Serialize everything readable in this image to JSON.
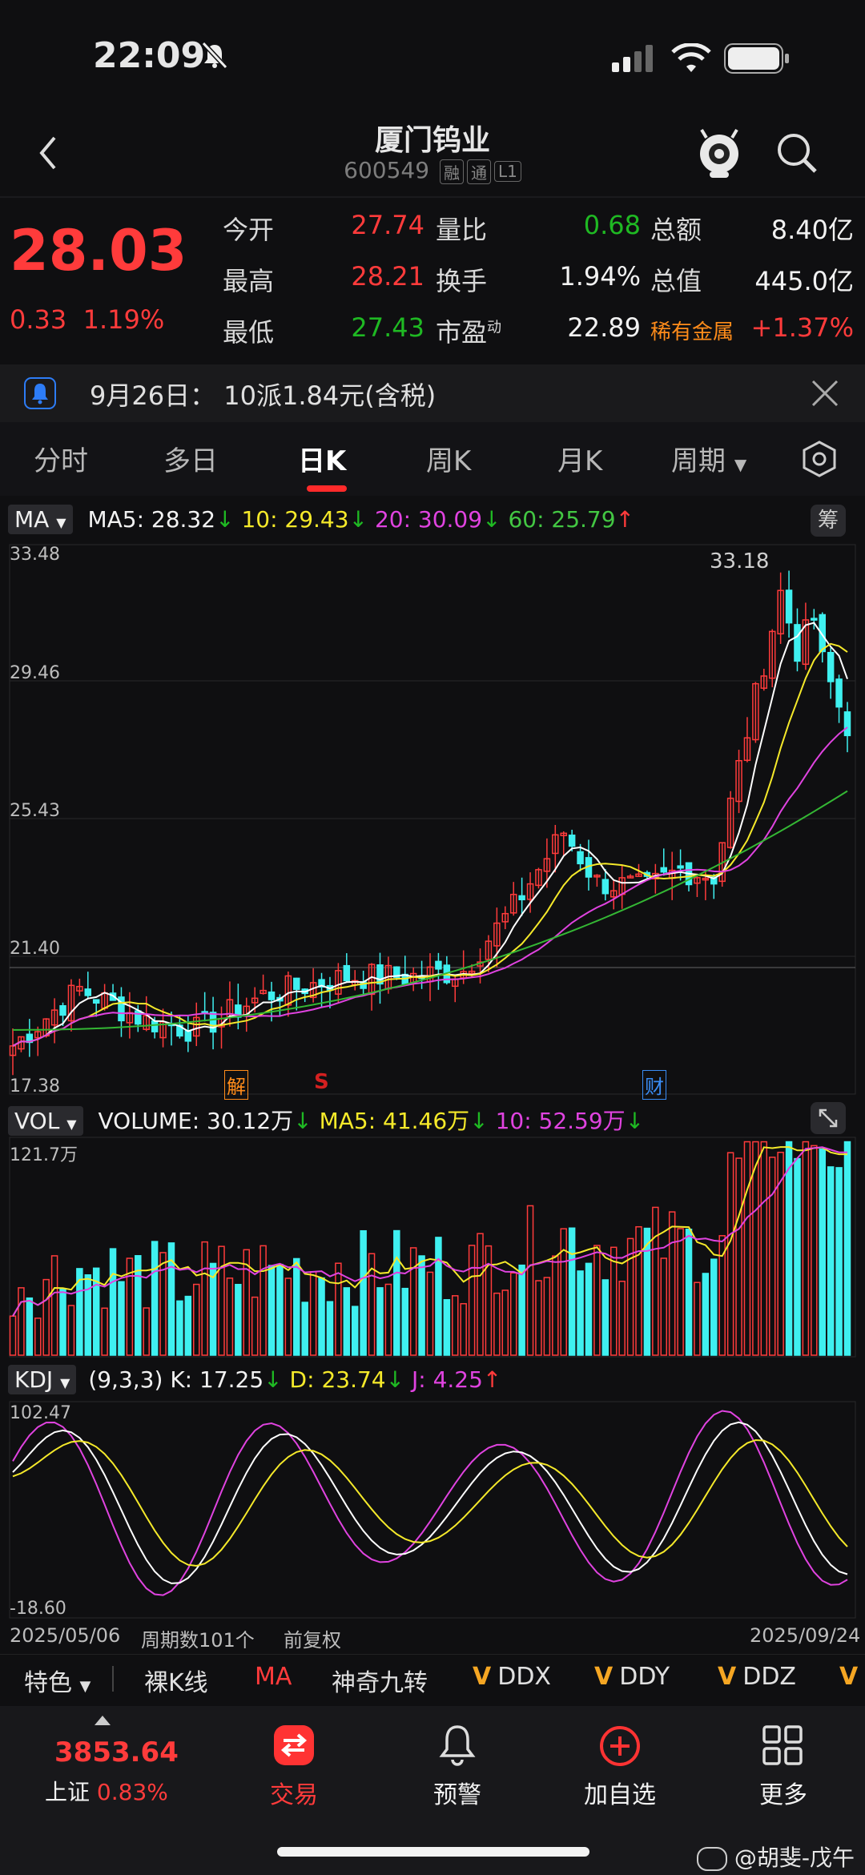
{
  "status": {
    "time": "22:09"
  },
  "nav": {
    "title": "厦门钨业",
    "code": "600549",
    "tags": [
      "融",
      "通",
      "L1"
    ]
  },
  "quote": {
    "price": "28.03",
    "change": "0.33",
    "change_pct": "1.19%",
    "rows": [
      [
        {
          "label": "今开",
          "value": "27.74",
          "color": "red"
        },
        {
          "label": "量比",
          "value": "0.68",
          "color": "green"
        },
        {
          "label": "总额",
          "value": "8.40亿",
          "color": "white"
        }
      ],
      [
        {
          "label": "最高",
          "value": "28.21",
          "color": "red"
        },
        {
          "label": "换手",
          "value": "1.94%",
          "color": "white"
        },
        {
          "label": "总值",
          "value": "445.0亿",
          "color": "white"
        }
      ],
      [
        {
          "label": "最低",
          "value": "27.43",
          "color": "green"
        },
        {
          "label": "市盈",
          "sup": "动",
          "value": "22.89",
          "color": "white"
        },
        {
          "label": "稀有金属",
          "value": "+1.37%",
          "color": "red"
        }
      ]
    ]
  },
  "notice": {
    "text": "9月26日：  10派1.84元(含税)"
  },
  "tabs": [
    "分时",
    "多日",
    "日K",
    "周K",
    "月K",
    "周期"
  ],
  "active_tab": 2,
  "ma_legend": {
    "selector": "MA",
    "ma5": "MA5: 28.32",
    "ma10": "10: 29.43",
    "ma20": "20: 30.09",
    "ma60": "60: 25.79",
    "badge": "筹"
  },
  "price_axis": [
    "33.48",
    "29.46",
    "25.43",
    "21.40",
    "17.38"
  ],
  "peak_label": "33.18",
  "markers": {
    "jie": "解",
    "s": "S",
    "cai": "财"
  },
  "vol_legend": {
    "selector": "VOL",
    "volume": "VOLUME: 30.12万",
    "ma5": "MA5: 41.46万",
    "ma10": "10: 52.59万"
  },
  "vol_axis": [
    "121.7万"
  ],
  "kdj_legend": {
    "selector": "KDJ",
    "params": "(9,3,3)",
    "k": "K: 17.25",
    "d": "D: 23.74",
    "j": "J: 4.25"
  },
  "kdj_axis": [
    "102.47",
    "-18.60"
  ],
  "footer": {
    "start_date": "2025/05/06",
    "periods": "周期数101个",
    "adjust": "前复权",
    "end_date": "2025/09/24"
  },
  "toolbar": [
    "特色",
    "裸K线",
    "MA",
    "神奇九转",
    "DDX",
    "DDY",
    "DDZ"
  ],
  "index": {
    "value": "3853.64",
    "name": "上证",
    "pct": "0.83%"
  },
  "bottom_nav": [
    "交易",
    "预警",
    "加自选",
    "更多"
  ],
  "watermark": "@胡斐-戊午",
  "colors": {
    "up": "#ff3b3b",
    "down": "#3ff0f0",
    "ma5": "#ffffff",
    "ma10": "#f5e92a",
    "ma20": "#e043e0",
    "ma60": "#34b734"
  }
}
